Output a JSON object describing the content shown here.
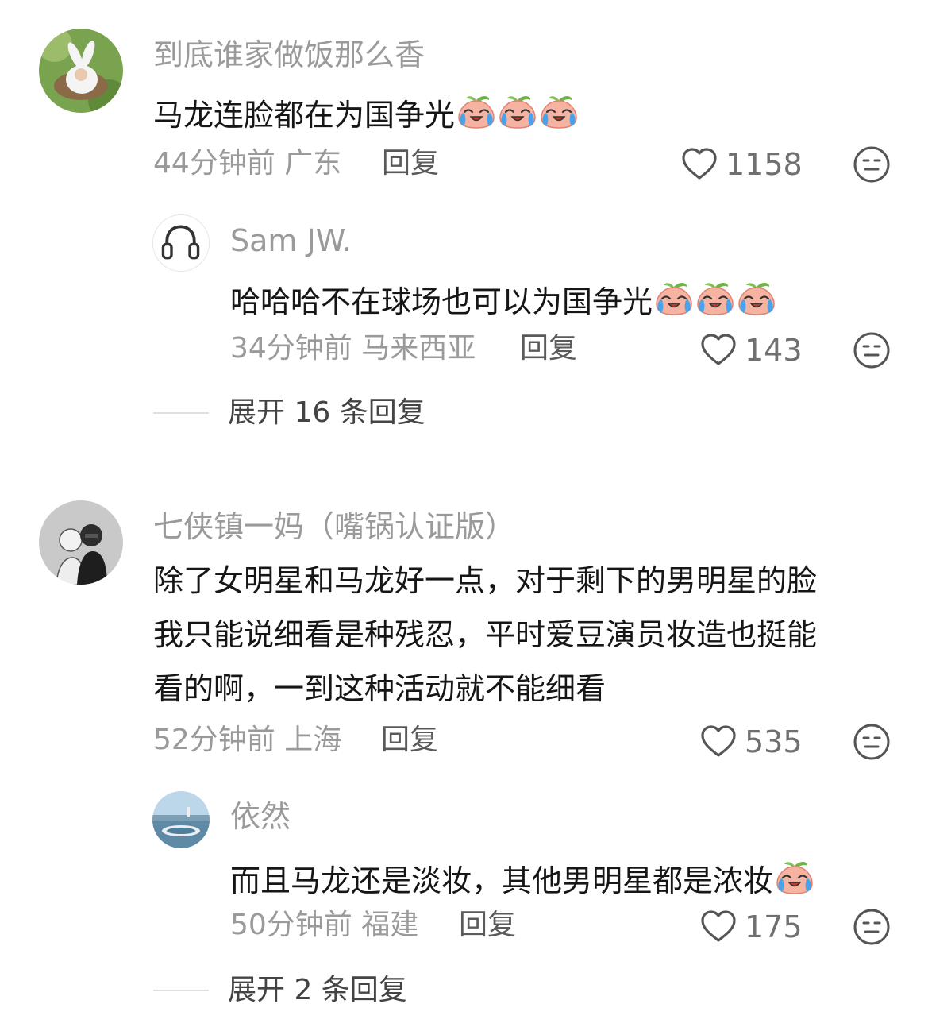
{
  "comments": [
    {
      "username": "到底谁家做饭那么香",
      "text": "马龙连脸都在为国争光",
      "emoji": "crying-peach-emoji",
      "emoji_count": 3,
      "time": "44分钟前",
      "location": "广东",
      "reply_label": "回复",
      "likes": "1158",
      "reply": {
        "username": "Sam JW.",
        "text": "哈哈哈不在球场也可以为国争光",
        "emoji": "crying-peach-emoji",
        "emoji_count": 3,
        "time": "34分钟前",
        "location": "马来西亚",
        "reply_label": "回复",
        "likes": "143"
      },
      "expand_label": "展开 16 条回复"
    },
    {
      "username": "七侠镇一妈（嘴锅认证版）",
      "text_lines": [
        "除了女明星和马龙好一点，对于剩下的男明星的脸",
        "我只能说细看是种残忍，平时爱豆演员妆造也挺能",
        "看的啊，一到这种活动就不能细看"
      ],
      "time": "52分钟前",
      "location": "上海",
      "reply_label": "回复",
      "likes": "535",
      "reply": {
        "username": "依然",
        "text": "而且马龙还是淡妆，其他男明星都是浓妆",
        "emoji": "crying-peach-emoji",
        "emoji_count": 1,
        "time": "50分钟前",
        "location": "福建",
        "reply_label": "回复",
        "likes": "175"
      },
      "expand_label": "展开 2 条回复"
    }
  ],
  "icons": {
    "like": "heart-outline-icon",
    "dislike": "neutral-face-icon",
    "headphones": "headphones-icon"
  },
  "colors": {
    "username": "#9a9a9a",
    "text": "#161616",
    "meta": "#9a9a9a"
  }
}
